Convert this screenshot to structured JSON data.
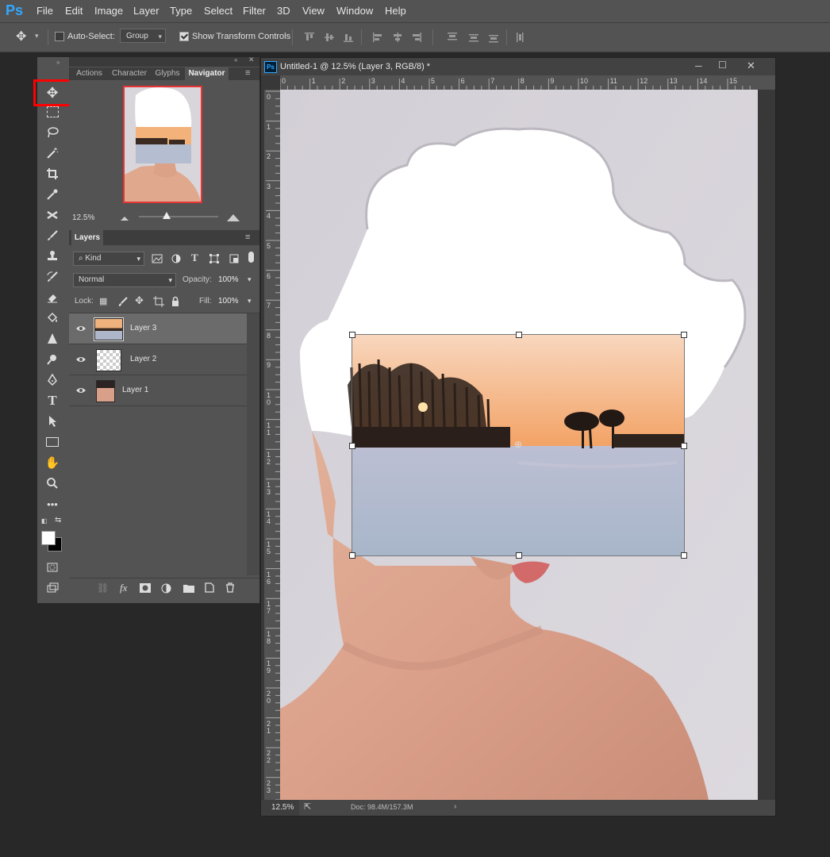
{
  "app": {
    "logo": "Ps"
  },
  "menu": [
    "File",
    "Edit",
    "Image",
    "Layer",
    "Type",
    "Select",
    "Filter",
    "3D",
    "View",
    "Window",
    "Help"
  ],
  "options_bar": {
    "auto_select_label": "Auto-Select:",
    "auto_select_checked": false,
    "auto_select_target": "Group",
    "show_transform_label": "Show Transform Controls",
    "show_transform_checked": true
  },
  "navigator": {
    "tabs": [
      "Actions",
      "Character",
      "Glyphs",
      "Navigator"
    ],
    "active_tab": "Navigator",
    "zoom": "12.5%"
  },
  "layers_panel": {
    "tab": "Layers",
    "filter_kind": "Kind",
    "blend_mode": "Normal",
    "opacity_label": "Opacity:",
    "opacity": "100%",
    "lock_label": "Lock:",
    "fill_label": "Fill:",
    "fill": "100%",
    "layers": [
      {
        "name": "Layer 3",
        "selected": true
      },
      {
        "name": "Layer 2",
        "selected": false
      },
      {
        "name": "Layer 1",
        "selected": false
      }
    ],
    "footer_fx": "fx"
  },
  "document": {
    "title": "Untitled-1 @ 12.5% (Layer 3, RGB/8) *",
    "tab_icon": "Ps",
    "ruler_h": [
      "0",
      "1",
      "2",
      "3",
      "4",
      "5",
      "6",
      "7",
      "8",
      "9",
      "10",
      "11",
      "12",
      "13",
      "14",
      "15"
    ],
    "ruler_v": [
      "0",
      "1",
      "2",
      "3",
      "4",
      "5",
      "6",
      "7",
      "8",
      "9",
      "10",
      "11",
      "12",
      "13",
      "14",
      "15",
      "16",
      "17",
      "18",
      "19",
      "20",
      "21",
      "22",
      "23"
    ],
    "status_zoom": "12.5%",
    "doc_size": "Doc: 98.4M/157.3M"
  },
  "colors": {
    "accent": "#31a8ff",
    "highlight": "#ff0000",
    "panel": "#535353"
  }
}
